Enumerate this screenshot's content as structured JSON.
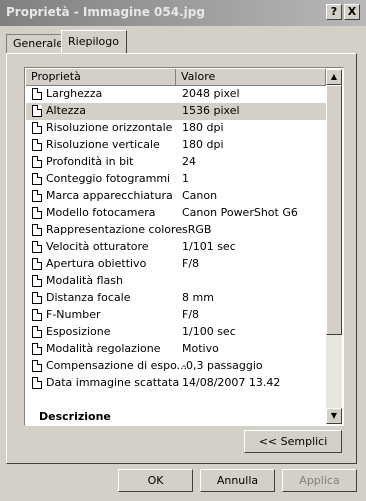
{
  "window": {
    "title": "Proprietà - Immagine 054.jpg",
    "help_label": "?",
    "close_label": "X"
  },
  "tabs": [
    {
      "label": "Generale",
      "active": false
    },
    {
      "label": "Riepilogo",
      "active": true
    }
  ],
  "list": {
    "columns": [
      "Proprietà",
      "Valore"
    ],
    "rows": [
      {
        "prop": "Larghezza",
        "val": "2048 pixel"
      },
      {
        "prop": "Altezza",
        "val": "1536 pixel",
        "selected": true
      },
      {
        "prop": "Risoluzione orizzontale",
        "val": "180 dpi"
      },
      {
        "prop": "Risoluzione verticale",
        "val": "180 dpi"
      },
      {
        "prop": "Profondità in bit",
        "val": "24"
      },
      {
        "prop": "Conteggio fotogrammi",
        "val": "1"
      },
      {
        "prop": "Marca apparecchiatura",
        "val": "Canon"
      },
      {
        "prop": "Modello fotocamera",
        "val": "Canon PowerShot G6"
      },
      {
        "prop": "Rappresentazione colore",
        "val": "sRGB"
      },
      {
        "prop": "Velocità otturatore",
        "val": "1/101 sec"
      },
      {
        "prop": "Apertura obiettivo",
        "val": "F/8"
      },
      {
        "prop": "Modalità flash",
        "val": ""
      },
      {
        "prop": "Distanza focale",
        "val": "8 mm"
      },
      {
        "prop": "F-Number",
        "val": "F/8"
      },
      {
        "prop": "Esposizione",
        "val": "1/100 sec"
      },
      {
        "prop": "Modalità regolazione",
        "val": "Motivo"
      },
      {
        "prop": "Compensazione di espo...",
        "val": "-0,3 passaggio"
      },
      {
        "prop": "Data immagine scattata",
        "val": "14/08/2007 13.42"
      }
    ],
    "section": "Descrizione"
  },
  "buttons": {
    "simple": "<< Semplici",
    "ok": "OK",
    "cancel": "Annulla",
    "apply": "Applica"
  }
}
